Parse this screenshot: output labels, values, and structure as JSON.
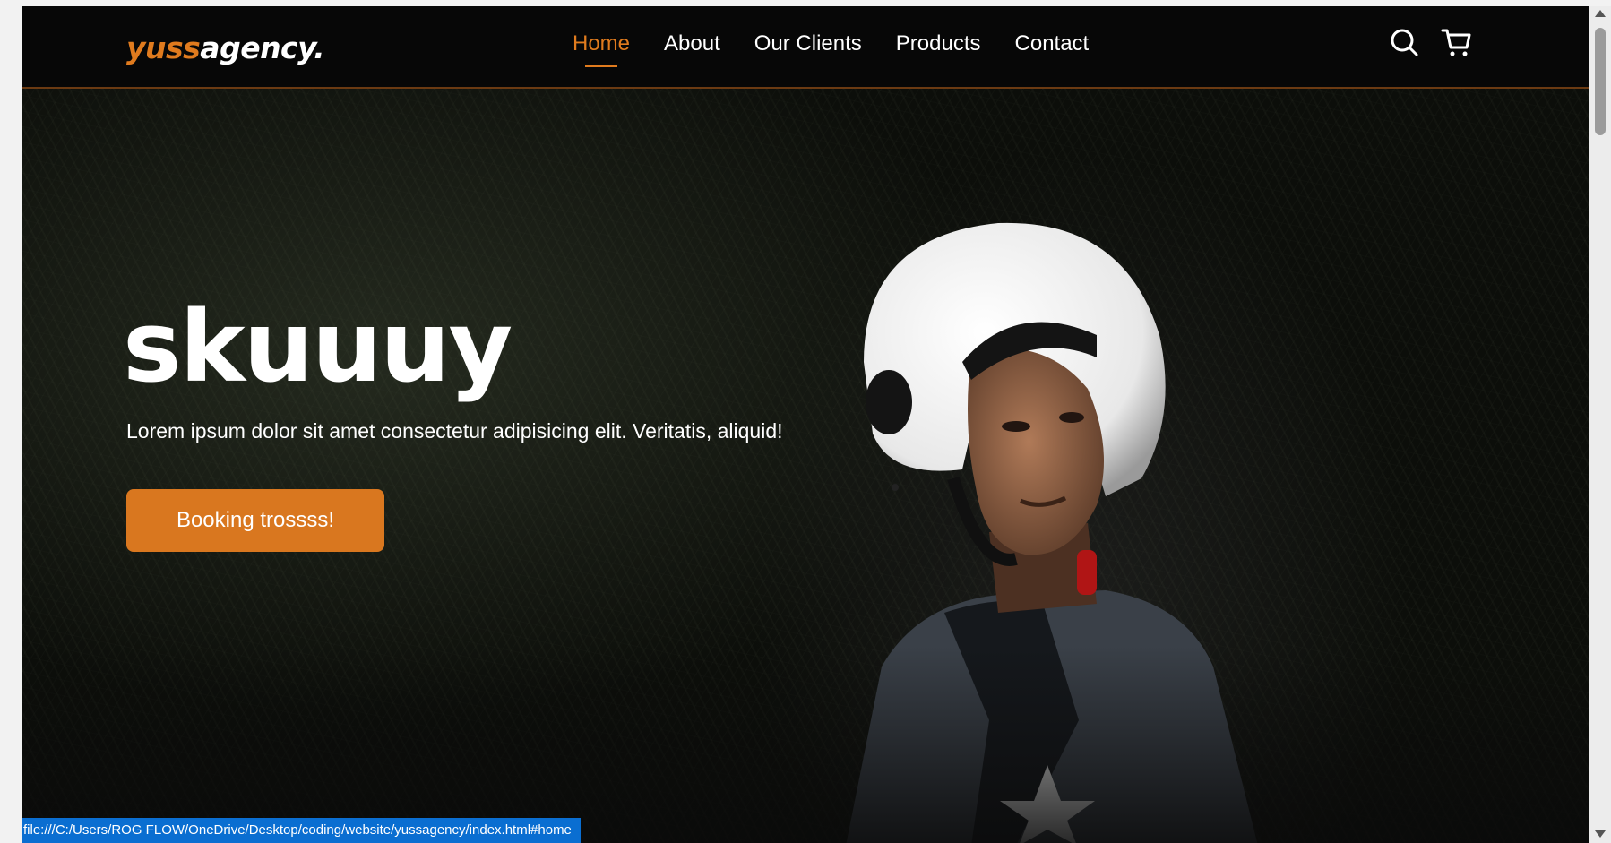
{
  "brand": {
    "logo_accent": "yuss",
    "logo_rest": "agency.",
    "accent_color": "#e07b1e"
  },
  "nav": {
    "links": [
      {
        "label": "Home",
        "active": true
      },
      {
        "label": "About",
        "active": false
      },
      {
        "label": "Our Clients",
        "active": false
      },
      {
        "label": "Products",
        "active": false
      },
      {
        "label": "Contact",
        "active": false
      }
    ],
    "icons": [
      "search-icon",
      "cart-icon"
    ]
  },
  "hero": {
    "title": "skuuuy",
    "text": "Lorem ipsum dolor sit amet consectetur adipisicing elit. Veritatis, aliquid!",
    "cta_label": "Booking trossss!",
    "cta_color": "#d9771f"
  },
  "status": {
    "url": "file:///C:/Users/ROG FLOW/OneDrive/Desktop/coding/website/yussagency/index.html#home"
  }
}
